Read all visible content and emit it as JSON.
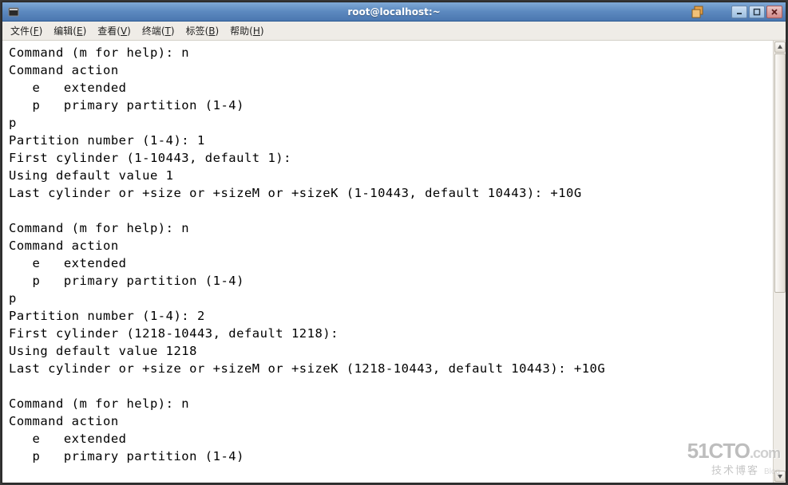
{
  "window": {
    "title": "root@localhost:~"
  },
  "menubar": {
    "items": [
      {
        "label": "文件",
        "accel": "F"
      },
      {
        "label": "编辑",
        "accel": "E"
      },
      {
        "label": "查看",
        "accel": "V"
      },
      {
        "label": "终端",
        "accel": "T"
      },
      {
        "label": "标签",
        "accel": "B"
      },
      {
        "label": "帮助",
        "accel": "H"
      }
    ]
  },
  "terminal": {
    "lines": [
      "Command (m for help): n",
      "Command action",
      "   e   extended",
      "   p   primary partition (1-4)",
      "p",
      "Partition number (1-4): 1",
      "First cylinder (1-10443, default 1): ",
      "Using default value 1",
      "Last cylinder or +size or +sizeM or +sizeK (1-10443, default 10443): +10G",
      "",
      "Command (m for help): n",
      "Command action",
      "   e   extended",
      "   p   primary partition (1-4)",
      "p",
      "Partition number (1-4): 2",
      "First cylinder (1218-10443, default 1218): ",
      "Using default value 1218",
      "Last cylinder or +size or +sizeM or +sizeK (1218-10443, default 10443): +10G",
      "",
      "Command (m for help): n",
      "Command action",
      "   e   extended",
      "   p   primary partition (1-4)"
    ]
  },
  "watermark": {
    "line1a": "51CTO",
    "line1b": ".com",
    "line2a": "技术博客",
    "line2b": "Blog"
  }
}
